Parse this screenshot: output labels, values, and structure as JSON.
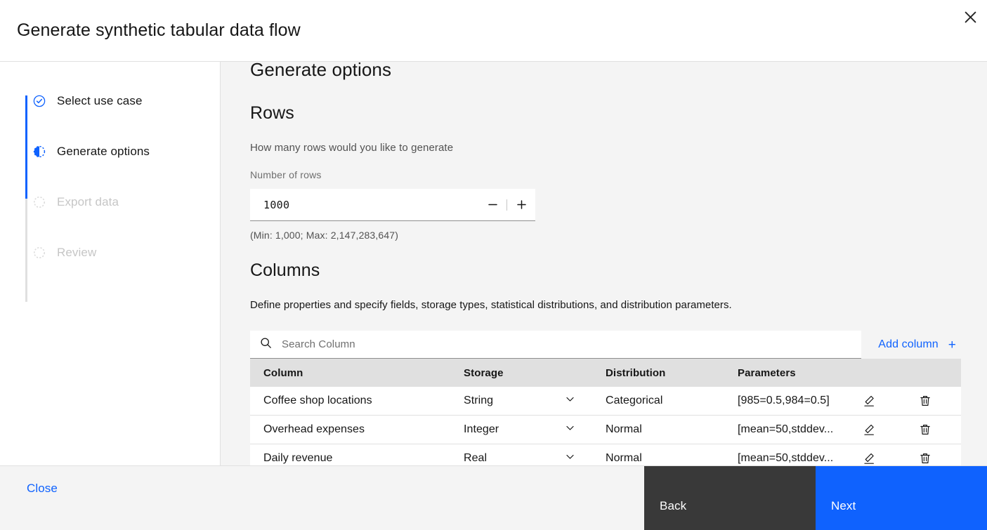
{
  "header": {
    "title": "Generate synthetic tabular data flow",
    "close_icon": "close-icon"
  },
  "sidebar": {
    "steps": [
      {
        "label": "Select use case",
        "state": "complete",
        "icon": "check-circle-icon"
      },
      {
        "label": "Generate options",
        "state": "current",
        "icon": "half-circle-icon"
      },
      {
        "label": "Export data",
        "state": "incomplete",
        "icon": "dashed-circle-icon"
      },
      {
        "label": "Review",
        "state": "incomplete",
        "icon": "dashed-circle-icon"
      }
    ]
  },
  "main": {
    "section_title": "Generate options",
    "rows": {
      "heading": "Rows",
      "help_text": "How many rows would you like to generate",
      "field_label": "Number of rows",
      "value": "1000",
      "decrement_label": "−",
      "increment_label": "+",
      "range_text": "(Min: 1,000; Max: 2,147,283,647)"
    },
    "columns": {
      "heading": "Columns",
      "description": "Define properties and specify fields, storage types, statistical distributions, and distribution parameters.",
      "search_placeholder": "Search Column",
      "search_value": "",
      "add_column_label": "Add column",
      "add_column_plus": "+",
      "table": {
        "headers": [
          "Column",
          "Storage",
          "Distribution",
          "Parameters",
          "",
          ""
        ],
        "rows": [
          {
            "column": "Coffee shop locations",
            "storage": "String",
            "distribution": "Categorical",
            "parameters": "[985=0.5,984=0.5]"
          },
          {
            "column": "Overhead expenses",
            "storage": "Integer",
            "distribution": "Normal",
            "parameters": "[mean=50,stddev..."
          },
          {
            "column": "Daily revenue",
            "storage": "Real",
            "distribution": "Normal",
            "parameters": "[mean=50,stddev..."
          }
        ]
      }
    }
  },
  "footer": {
    "close_label": "Close",
    "back_label": "Back",
    "next_label": "Next"
  },
  "colors": {
    "accent_blue": "#0f62fe",
    "dark_gray": "#393939",
    "page_bg": "#f4f4f4",
    "table_header_bg": "#e0e0e0",
    "disabled_text": "#c6c6c6"
  }
}
